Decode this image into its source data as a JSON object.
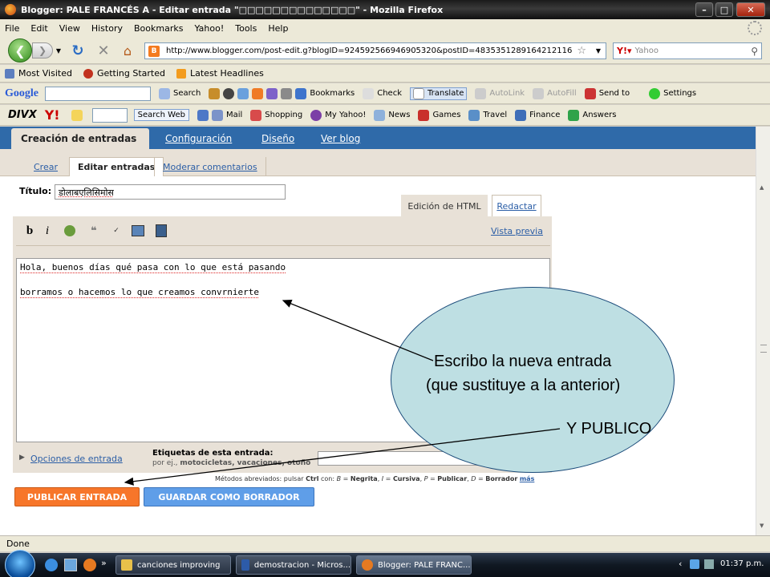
{
  "window": {
    "title": "Blogger: PALE FRANCÉS A - Editar entrada \"□□□□□□□□□□□□□□\" - Mozilla Firefox"
  },
  "menu": [
    "File",
    "Edit",
    "View",
    "History",
    "Bookmarks",
    "Yahoo!",
    "Tools",
    "Help"
  ],
  "nav": {
    "url": "http://www.blogger.com/post-edit.g?blogID=924592566946905320&postID=4835351289164212116",
    "search_placeholder": "Yahoo"
  },
  "bookmarks": [
    "Most Visited",
    "Getting Started",
    "Latest Headlines"
  ],
  "google_toolbar": {
    "brand": "Google",
    "items": [
      "Search",
      "Bookmarks",
      "Check",
      "Translate",
      "AutoLink",
      "AutoFill",
      "Send to",
      "Settings"
    ]
  },
  "yahoo_toolbar": {
    "brand": "DIVX",
    "search_button": "Search Web",
    "items": [
      "Mail",
      "Shopping",
      "My Yahoo!",
      "News",
      "Games",
      "Travel",
      "Finance",
      "Answers"
    ]
  },
  "blogger": {
    "main_tabs": [
      "Creación de entradas",
      "Configuración",
      "Diseño",
      "Ver blog"
    ],
    "sub_tabs": [
      "Crear",
      "Editar entradas",
      "Moderar comentarios"
    ],
    "title_label": "Título:",
    "title_value": "डोलाबएलिसिमोस",
    "editor_tabs": [
      "Edición de HTML",
      "Redactar"
    ],
    "preview_link": "Vista previa",
    "editor_lines": [
      "Hola, buenos días qué pasa  con lo que está pasando",
      "borramos o hacemos lo que  creamos convrnierte"
    ],
    "post_options": "Opciones de entrada",
    "labels_title": "Etiquetas de esta entrada:",
    "labels_hint_prefix": "por ej., ",
    "labels_hint_examples": "motocicletas, vacaciones, otoño",
    "shortcuts_prefix": "Métodos abreviados: pulsar ",
    "shortcuts_key": "Ctrl",
    "shortcuts_con": " con: ",
    "shortcuts_b": "B",
    "shortcuts_b_label": "Negrita",
    "shortcuts_i": "I",
    "shortcuts_i_label": "Cursiva",
    "shortcuts_p": "P",
    "shortcuts_p_label": "Publicar",
    "shortcuts_d": "D",
    "shortcuts_d_label": "Borrador",
    "shortcuts_more": "más",
    "publish_button": "PUBLICAR ENTRADA",
    "draft_button": "GUARDAR COMO BORRADOR"
  },
  "annotation": {
    "line1": "Escribo la nueva entrada",
    "line2": "(que sustituye a la anterior)",
    "line3": "Y PUBLICO"
  },
  "status": "Done",
  "taskbar": {
    "tasks": [
      "canciones improving",
      "demostracion - Micros...",
      "Blogger: PALE FRANC..."
    ],
    "clock": "01:37 p.m."
  },
  "colors": {
    "publish": "#f7762a",
    "draft": "#5f9ee8",
    "tab_blue": "#2f6aa9",
    "ellipse": "#bedfe3"
  }
}
